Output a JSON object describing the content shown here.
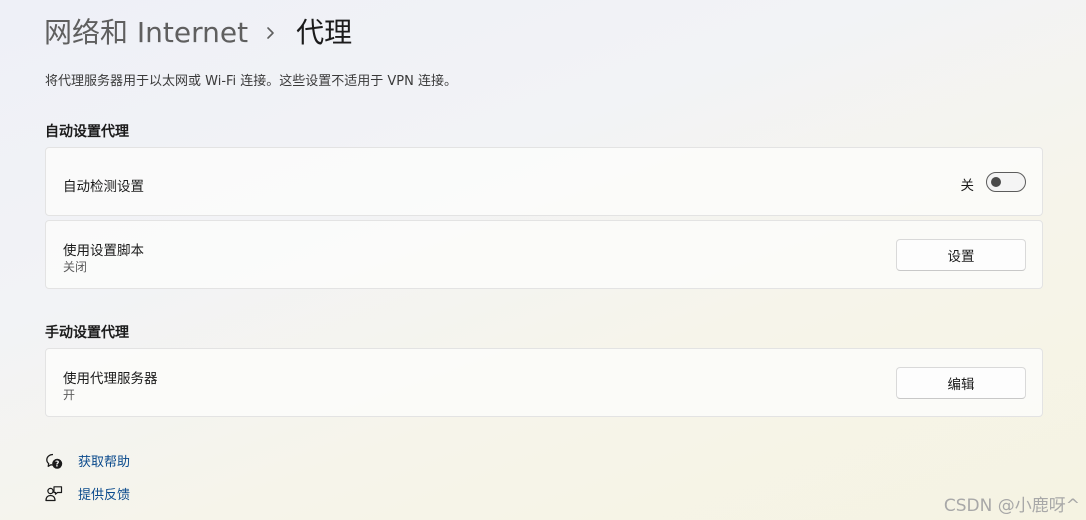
{
  "breadcrumb": {
    "parent": "网络和 Internet",
    "current": "代理"
  },
  "description": "将代理服务器用于以太网或 Wi-Fi 连接。这些设置不适用于 VPN 连接。",
  "auto_section": {
    "title": "自动设置代理",
    "detect": {
      "label": "自动检测设置",
      "state_label": "关",
      "on": false
    },
    "script": {
      "label": "使用设置脚本",
      "sublabel": "关闭",
      "button": "设置"
    }
  },
  "manual_section": {
    "title": "手动设置代理",
    "proxy": {
      "label": "使用代理服务器",
      "sublabel": "开",
      "button": "编辑"
    }
  },
  "links": {
    "help": "获取帮助",
    "feedback": "提供反馈"
  },
  "watermark": "CSDN @小鹿呀^",
  "icons": {
    "breadcrumb_separator": "chevron-right-icon",
    "help": "help-chat-icon",
    "feedback": "feedback-person-icon"
  },
  "colors": {
    "link": "#0a4a8c",
    "toggle_border": "#5c5c5c"
  }
}
